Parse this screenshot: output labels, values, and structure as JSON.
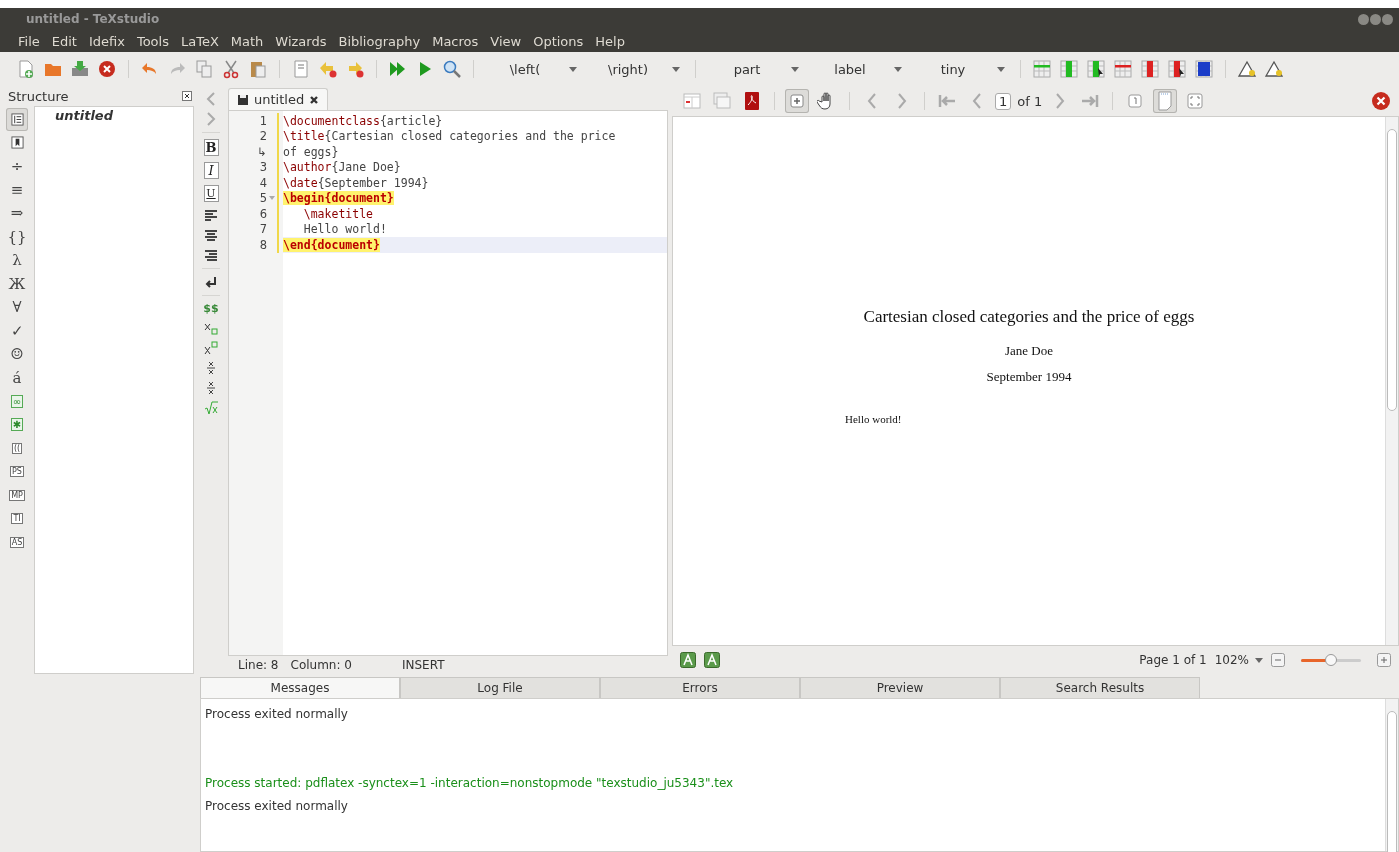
{
  "window": {
    "title": "untitled - TeXstudio"
  },
  "menu": [
    "File",
    "Edit",
    "Idefix",
    "Tools",
    "LaTeX",
    "Math",
    "Wizards",
    "Bibliography",
    "Macros",
    "View",
    "Options",
    "Help"
  ],
  "toolbar": [
    {
      "kind": "new-document"
    },
    {
      "kind": "folder"
    },
    {
      "kind": "disk"
    },
    {
      "kind": "close"
    },
    {
      "kind": "sep"
    },
    {
      "kind": "undo"
    },
    {
      "kind": "redo"
    },
    {
      "kind": "copy"
    },
    {
      "kind": "scissors"
    },
    {
      "kind": "clipboard"
    },
    {
      "kind": "sep"
    },
    {
      "kind": "document"
    },
    {
      "kind": "bookmark-left"
    },
    {
      "kind": "bookmark-right"
    },
    {
      "kind": "sep"
    },
    {
      "kind": "double-play"
    },
    {
      "kind": "play"
    },
    {
      "kind": "magnifier"
    },
    {
      "kind": "sep"
    },
    {
      "kind": "dropdown",
      "label": "\\left("
    },
    {
      "kind": "dropdown",
      "label": "\\right)"
    },
    {
      "kind": "sep"
    },
    {
      "kind": "dropdown",
      "label": "part"
    },
    {
      "kind": "dropdown",
      "label": "label"
    },
    {
      "kind": "dropdown",
      "label": "tiny"
    },
    {
      "kind": "sep"
    },
    {
      "kind": "table-row"
    },
    {
      "kind": "table-column"
    },
    {
      "kind": "table-column-cursor"
    },
    {
      "kind": "table-row-remove"
    },
    {
      "kind": "table-column-remove"
    },
    {
      "kind": "table-column-remove-cursor"
    },
    {
      "kind": "table-align"
    },
    {
      "kind": "sep"
    },
    {
      "kind": "triangle"
    },
    {
      "kind": "triangle"
    }
  ],
  "structure": {
    "title": "Structure",
    "symbols": [
      {
        "kind": "list",
        "selected": true
      },
      {
        "kind": "bookmark",
        "selected": false
      },
      {
        "kind": "glyph",
        "label": "÷",
        "selected": false
      },
      {
        "kind": "glyph",
        "label": "≡",
        "selected": false
      },
      {
        "kind": "glyph",
        "label": "⇒",
        "selected": false
      },
      {
        "kind": "glyph",
        "label": "{}",
        "selected": false
      },
      {
        "kind": "glyph",
        "label": "λ",
        "selected": false
      },
      {
        "kind": "glyph",
        "label": "Ж",
        "selected": false
      },
      {
        "kind": "glyph",
        "label": "∀",
        "selected": false
      },
      {
        "kind": "glyph",
        "label": "✓",
        "selected": false
      },
      {
        "kind": "glyph",
        "label": "☺",
        "selected": false
      },
      {
        "kind": "glyph",
        "label": "á",
        "selected": false
      },
      {
        "kind": "green-box",
        "label": "∞",
        "selected": false
      },
      {
        "kind": "green-box",
        "label": "✱",
        "selected": false
      },
      {
        "kind": "boxed",
        "label": "((",
        "selected": false
      },
      {
        "kind": "boxed",
        "label": "PS",
        "selected": false
      },
      {
        "kind": "boxed",
        "label": "MP",
        "selected": false
      },
      {
        "kind": "boxed",
        "label": "TI",
        "selected": false
      },
      {
        "kind": "boxed",
        "label": "AS",
        "selected": false
      }
    ],
    "tree": [
      {
        "label": "untitled"
      }
    ]
  },
  "format_bar": [
    {
      "kind": "bold",
      "label": "B"
    },
    {
      "kind": "italic",
      "label": "I"
    },
    {
      "kind": "underline",
      "label": "U"
    },
    {
      "kind": "align-left"
    },
    {
      "kind": "align-center"
    },
    {
      "kind": "align-right"
    },
    {
      "kind": "sep"
    },
    {
      "kind": "return"
    },
    {
      "kind": "sep"
    },
    {
      "kind": "dollars",
      "label": "$$"
    },
    {
      "kind": "subscript"
    },
    {
      "kind": "superscript"
    },
    {
      "kind": "fraction"
    },
    {
      "kind": "fraction"
    },
    {
      "kind": "root"
    }
  ],
  "editor": {
    "tab": {
      "label": "untitled"
    },
    "lines": [
      {
        "number": "1",
        "fold": false,
        "current": false,
        "segments": [
          {
            "kind": "command",
            "text": "\\documentclass"
          },
          {
            "kind": "plain",
            "text": "{article}"
          }
        ]
      },
      {
        "number": "2",
        "fold": false,
        "current": false,
        "segments": [
          {
            "kind": "command",
            "text": "\\title"
          },
          {
            "kind": "plain",
            "text": "{Cartesian closed categories and the price"
          }
        ]
      },
      {
        "number": "↳",
        "fold": false,
        "current": false,
        "segments": [
          {
            "kind": "plain",
            "text": "of eggs}"
          }
        ]
      },
      {
        "number": "3",
        "fold": false,
        "current": false,
        "segments": [
          {
            "kind": "command",
            "text": "\\author"
          },
          {
            "kind": "plain",
            "text": "{Jane Doe}"
          }
        ]
      },
      {
        "number": "4",
        "fold": false,
        "current": false,
        "segments": [
          {
            "kind": "command",
            "text": "\\date"
          },
          {
            "kind": "plain",
            "text": "{September 1994}"
          }
        ]
      },
      {
        "number": "5",
        "fold": true,
        "current": false,
        "segments": [
          {
            "kind": "environment",
            "text": "\\begin{document}"
          }
        ]
      },
      {
        "number": "6",
        "fold": false,
        "current": false,
        "segments": [
          {
            "kind": "command",
            "text": "   \\maketitle"
          }
        ]
      },
      {
        "number": "7",
        "fold": false,
        "current": false,
        "segments": [
          {
            "kind": "plain",
            "text": "   Hello world!"
          }
        ]
      },
      {
        "number": "8",
        "fold": false,
        "current": true,
        "segments": [
          {
            "kind": "environment",
            "text": "\\end{document}"
          }
        ]
      }
    ],
    "status": {
      "line": "Line: 8",
      "column": "Column: 0",
      "mode": "INSERT"
    }
  },
  "viewer": {
    "toolbar": [
      {
        "kind": "layout-split",
        "selected": false
      },
      {
        "kind": "windows",
        "selected": false
      },
      {
        "kind": "pdf-reader",
        "selected": false
      },
      {
        "kind": "sep"
      },
      {
        "kind": "zoom-box",
        "selected": true
      },
      {
        "kind": "hand",
        "selected": false
      },
      {
        "kind": "sep"
      },
      {
        "kind": "chevron-left",
        "selected": false
      },
      {
        "kind": "chevron-right",
        "selected": false
      },
      {
        "kind": "sep"
      },
      {
        "kind": "first",
        "selected": false
      },
      {
        "kind": "chevron-left",
        "selected": false
      },
      {
        "kind": "page-field",
        "value": "1",
        "label": "of 1"
      },
      {
        "kind": "chevron-right",
        "selected": false
      },
      {
        "kind": "last",
        "selected": false
      },
      {
        "kind": "sep"
      },
      {
        "kind": "single-page",
        "selected": false
      },
      {
        "kind": "continuous-page",
        "selected": true
      },
      {
        "kind": "fit",
        "selected": false
      }
    ],
    "document": {
      "title": "Cartesian closed categories and the price of eggs",
      "author": "Jane Doe",
      "date": "September 1994",
      "body": "Hello world!"
    },
    "page_status": "Page 1 of 1",
    "zoom": "102%",
    "zoom_slider": {
      "level": 0.5
    }
  },
  "messages": {
    "tabs": [
      {
        "label": "Messages",
        "selected": true
      },
      {
        "label": "Log File",
        "selected": false
      },
      {
        "label": "Errors",
        "selected": false
      },
      {
        "label": "Preview",
        "selected": false
      },
      {
        "label": "Search Results",
        "selected": false
      }
    ],
    "lines": [
      {
        "kind": "normal",
        "text": "Process exited normally"
      },
      {
        "kind": "blank"
      },
      {
        "kind": "started",
        "text": "Process started: pdflatex -synctex=1 -interaction=nonstopmode \"texstudio_ju5343\".tex"
      },
      {
        "kind": "normal",
        "text": "Process exited normally"
      }
    ]
  }
}
